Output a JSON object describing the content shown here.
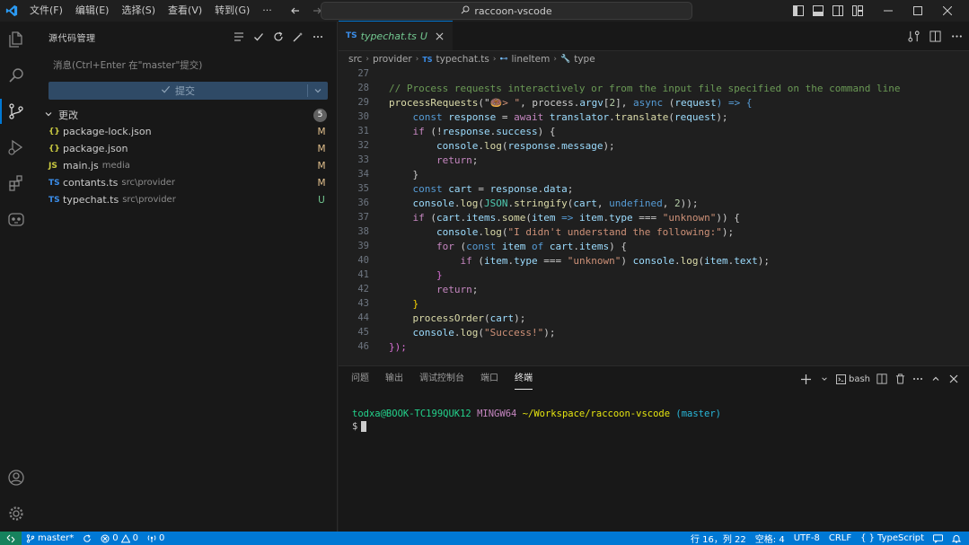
{
  "titlebar": {
    "menu": [
      "文件(F)",
      "编辑(E)",
      "选择(S)",
      "查看(V)",
      "转到(G)",
      "···"
    ],
    "search_text": "raccoon-vscode"
  },
  "sidebar": {
    "title": "源代码管理",
    "commit_placeholder": "消息(Ctrl+Enter 在\"master\"提交)",
    "commit_label": "提交",
    "changes_label": "更改",
    "changes_count": "5",
    "files": [
      {
        "icon": "{}",
        "name": "package-lock.json",
        "dir": "",
        "status": "M",
        "icon_color": "#cbcb41"
      },
      {
        "icon": "{}",
        "name": "package.json",
        "dir": "",
        "status": "M",
        "icon_color": "#cbcb41"
      },
      {
        "icon": "JS",
        "name": "main.js",
        "dir": "media",
        "status": "M",
        "icon_color": "#cbcb41"
      },
      {
        "icon": "TS",
        "name": "contants.ts",
        "dir": "src\\provider",
        "status": "M",
        "icon_color": "#3b8eea"
      },
      {
        "icon": "TS",
        "name": "typechat.ts",
        "dir": "src\\provider",
        "status": "U",
        "icon_color": "#3b8eea"
      }
    ]
  },
  "editor": {
    "tab": {
      "icon": "TS",
      "label": "typechat.ts",
      "status": "U"
    },
    "breadcrumb": [
      "src",
      "provider",
      "typechat.ts",
      "lineItem",
      "type"
    ],
    "lines": [
      "27",
      "28",
      "29",
      "30",
      "31",
      "32",
      "33",
      "34",
      "35",
      "36",
      "37",
      "38",
      "39",
      "40",
      "41",
      "42",
      "43",
      "44",
      "45",
      "46"
    ],
    "code": {
      "l28": "// Process requests interactively or from the input file specified on the command line",
      "l29a": "processRequests",
      "l29b": "(\"",
      "l29c": "🍩> \"",
      "l29d": ", process.",
      "l29e": "argv",
      "l29f": "[",
      "l29g": "2",
      "l29h": "], ",
      "l29i": "async",
      "l29j": " (",
      "l29k": "request",
      "l29l": ") => {",
      "l30a": "const",
      "l30b": "response",
      "l30c": " = ",
      "l30d": "await",
      "l30e": "translator",
      "l30f": ".",
      "l30g": "translate",
      "l30h": "(",
      "l30i": "request",
      "l30j": ");",
      "l31a": "if",
      "l31b": " (!",
      "l31c": "response",
      "l31d": ".",
      "l31e": "success",
      "l31f": ") {",
      "l32a": "console",
      "l32b": ".",
      "l32c": "log",
      "l32d": "(",
      "l32e": "response",
      "l32f": ".",
      "l32g": "message",
      "l32h": ");",
      "l33": "return",
      "l34": "}",
      "l35a": "const",
      "l35b": "cart",
      "l35c": " = ",
      "l35d": "response",
      "l35e": ".",
      "l35f": "data",
      "l35g": ";",
      "l36a": "console",
      "l36b": ".",
      "l36c": "log",
      "l36d": "(",
      "l36e": "JSON",
      "l36f": ".",
      "l36g": "stringify",
      "l36h": "(",
      "l36i": "cart",
      "l36j": ", ",
      "l36k": "undefined",
      "l36l": ", ",
      "l36m": "2",
      "l36n": "));",
      "l37a": "if",
      "l37b": " (",
      "l37c": "cart",
      "l37d": ".",
      "l37e": "items",
      "l37f": ".",
      "l37g": "some",
      "l37h": "(",
      "l37i": "item",
      "l37j": " => ",
      "l37k": "item",
      "l37l": ".",
      "l37m": "type",
      "l37n": " === ",
      "l37o": "\"unknown\"",
      "l37p": ")) {",
      "l38a": "console",
      "l38b": ".",
      "l38c": "log",
      "l38d": "(",
      "l38e": "\"I didn't understand the following:\"",
      "l38f": ");",
      "l39a": "for",
      "l39b": " (",
      "l39c": "const",
      "l39d": "item",
      "l39e": " of ",
      "l39f": "cart",
      "l39g": ".",
      "l39h": "items",
      "l39i": ") {",
      "l40a": "if",
      "l40b": " (",
      "l40c": "item",
      "l40d": ".",
      "l40e": "type",
      "l40f": " === ",
      "l40g": "\"unknown\"",
      "l40h": ") ",
      "l40i": "console",
      "l40j": ".",
      "l40k": "log",
      "l40l": "(",
      "l40m": "item",
      "l40n": ".",
      "l40o": "text",
      "l40p": ");",
      "l41": "}",
      "l42": "return",
      "l42b": ";",
      "l43": "}",
      "l44a": "processOrder",
      "l44b": "(",
      "l44c": "cart",
      "l44d": ");",
      "l45a": "console",
      "l45b": ".",
      "l45c": "log",
      "l45d": "(",
      "l45e": "\"Success!\"",
      "l45f": ");",
      "l46": "});"
    }
  },
  "panel": {
    "tabs": [
      "问题",
      "输出",
      "调试控制台",
      "端口",
      "终端"
    ],
    "active_tab": "终端",
    "shell": "bash",
    "terminal": {
      "user_host": "todxa@BOOK-TC199QUK12",
      "env": "MINGW64",
      "path": "~/Workspace/raccoon-vscode",
      "branch": "(master)",
      "prompt": "$"
    }
  },
  "statusbar": {
    "branch": "master*",
    "errors": "0",
    "warnings": "0",
    "ports": "0",
    "position": "行 16，列 22",
    "spaces": "空格: 4",
    "encoding": "UTF-8",
    "eol": "CRLF",
    "language": "TypeScript"
  },
  "colors": {
    "accent": "#0078d4",
    "modified": "#e2c08d",
    "untracked": "#73c991"
  }
}
